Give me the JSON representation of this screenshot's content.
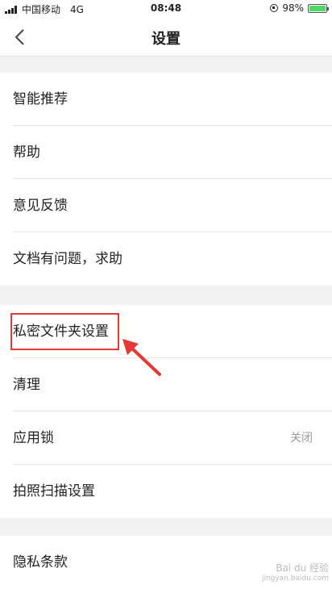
{
  "status_bar": {
    "carrier": "中国移动",
    "network": "4G",
    "time": "08:48",
    "battery": "98%",
    "battery_level": 0.98
  },
  "nav": {
    "title": "设置"
  },
  "groups": [
    {
      "items": [
        {
          "label": "智能推荐"
        },
        {
          "label": "帮助"
        },
        {
          "label": "意见反馈"
        },
        {
          "label": "文档有问题，求助"
        }
      ]
    },
    {
      "items": [
        {
          "label": "私密文件夹设置"
        },
        {
          "label": "清理"
        },
        {
          "label": "应用锁",
          "value": "关闭"
        },
        {
          "label": "拍照扫描设置"
        }
      ]
    },
    {
      "items": [
        {
          "label": "隐私条款"
        }
      ]
    }
  ],
  "watermark": {
    "line1": "Bai du 经验",
    "line2": "jingyan.baidu.com"
  },
  "colors": {
    "highlight": "#e53935",
    "battery": "#4cd964"
  }
}
